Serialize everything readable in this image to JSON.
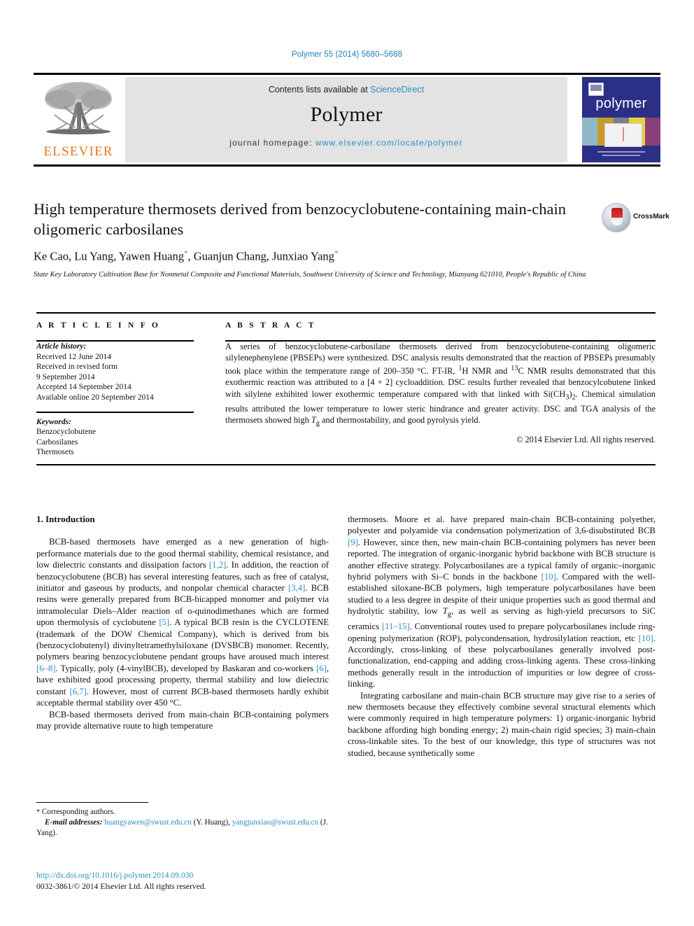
{
  "running_head": "Polymer 55 (2014) 5680–5688",
  "masthead": {
    "contents_prefix": "Contents lists available at ",
    "sciencedirect": "ScienceDirect",
    "journal_name": "Polymer",
    "homepage_label": "journal homepage:",
    "homepage_url": "www.elsevier.com/locate/polymer",
    "publisher_logo_text": "ELSEVIER",
    "cover_title": "polymer"
  },
  "article": {
    "title": "High temperature thermosets derived from benzocyclobutene-containing main-chain oligomeric carbosilanes",
    "authors": "Ke Cao, Lu Yang, Yawen Huang",
    "authors_full": "Ke Cao, Lu Yang, Yawen Huang*, Guanjun Chang, Junxiao Yang*",
    "affiliation": "State Key Laboratory Cultivation Base for Nonmetal Composite and Functional Materials, Southwest University of Science and Technology, Mianyang 621010, People's Republic of China",
    "crossmark_label": "CrossMark"
  },
  "info": {
    "heading": "A R T I C L E   I N F O",
    "history_label": "Article history:",
    "history": [
      "Received 12 June 2014",
      "Received in revised form",
      "9 September 2014",
      "Accepted 14 September 2014",
      "Available online 20 September 2014"
    ],
    "keywords_label": "Keywords:",
    "keywords": [
      "Benzocyclobutene",
      "Carbosilanes",
      "Thermosets"
    ]
  },
  "abstract": {
    "heading": "A B S T R A C T",
    "text": "A series of benzocyclobutene-carbosilane thermosets derived from benzocyclobutene-containing oligomeric silylenephenylene (PBSEPs) were synthesized. DSC analysis results demonstrated that the reaction of PBSEPs presumably took place within the temperature range of 200–350 °C. FT-IR, ¹H NMR and ¹³C NMR results demonstrated that this exothermic reaction was attributed to a [4 + 2] cycloaddition. DSC results further revealed that benzocylcobutene linked with silylene exhibited lower exothermic temperature compared with that linked with Si(CH₃)₂. Chemical simulation results attributed the lower temperature to lower steric hindrance and greater activity. DSC and TGA analysis of the thermosets showed high Tg and thermostability, and good pyrolysis yield.",
    "copyright": "© 2014 Elsevier Ltd. All rights reserved."
  },
  "body": {
    "section_heading": "1. Introduction",
    "left_paragraphs": [
      "BCB-based thermosets have emerged as a new generation of high-performance materials due to the good thermal stability, chemical resistance, and low dielectric constants and dissipation factors [1,2]. In addition, the reaction of benzocyclobutene (BCB) has several interesting features, such as free of catalyst, initiator and gaseous by products, and nonpolar chemical character [3,4]. BCB resins were generally prepared from BCB-bicapped monomer and polymer via intramolecular Diels–Alder reaction of o-quinodimethanes which are formed upon thermolysis of cyclobutene [5]. A typical BCB resin is the CYCLOTENE (trademark of the DOW Chemical Company), which is derived from bis (benzocyclobutenyl) divinyltetramethylsiloxane (DVSBCB) monomer. Recently, polymers bearing benzocyclobutene pendant groups have aroused much interest [6–8]. Typically, poly (4-vinylBCB), developed by Baskaran and co-workers [6], have exhibited good processing property, thermal stability and low dielectric constant [6,7]. However, most of current BCB-based thermosets hardly exhibit acceptable thermal stability over 450 °C.",
      "BCB-based thermosets derived from main-chain BCB-containing polymers may provide alternative route to high temperature"
    ],
    "right_paragraphs": [
      "thermosets. Moore et al. have prepared main-chain BCB-containing polyether, polyester and polyamide via condensation polymerization of 3,6-disubstituted BCB [9]. However, since then, new main-chain BCB-containing polymers has never been reported. The integration of organic-inorganic hybrid backbone with BCB structure is another effective strategy. Polycarbosilanes are a typical family of organic–inorganic hybrid polymers with Si–C bonds in the backbone [10]. Compared with the well-established siloxane-BCB polymers, high temperature polycarbosilanes have been studied to a less degree in despite of their unique properties such as good thermal and hydrolytic stability, low Tg, as well as serving as high-yield precursors to SiC ceramics [11–15]. Conventional routes used to prepare polycarbosilanes include ring-opening polymerization (ROP), polycondensation, hydrosilylation reaction, etc [10]. Accordingly, cross-linking of these polycarbosilanes generally involved post-functionalization, end-capping and adding cross-linking agents. These cross-linking methods generally result in the introduction of impurities or low degree of cross-linking.",
      "Integrating carbosilane and main-chain BCB structure may give rise to a series of new thermosets because they effectively combine several structural elements which were commonly required in high temperature polymers: 1) organic-inorganic hybrid backbone affording high bonding energy; 2) main-chain rigid species; 3) main-chain cross-linkable sites. To the best of our knowledge, this type of structures was not studied, because synthetically some"
    ]
  },
  "footnotes": {
    "corresponding": "Corresponding authors.",
    "email_label": "E-mail addresses:",
    "email1": "huangyawen@swust.edu.cn",
    "email1_owner": "(Y. Huang),",
    "email2": "yangjunxiao@swust.edu.cn",
    "email2_owner": "(J. Yang).",
    "doi": "http://dx.doi.org/10.1016/j.polymer.2014.09.030",
    "issn": "0032-3861/© 2014 Elsevier Ltd. All rights reserved."
  },
  "colors": {
    "link": "#2b8cc4",
    "elsevier_orange": "#e87722",
    "cover_blue": "#2c2f86"
  }
}
